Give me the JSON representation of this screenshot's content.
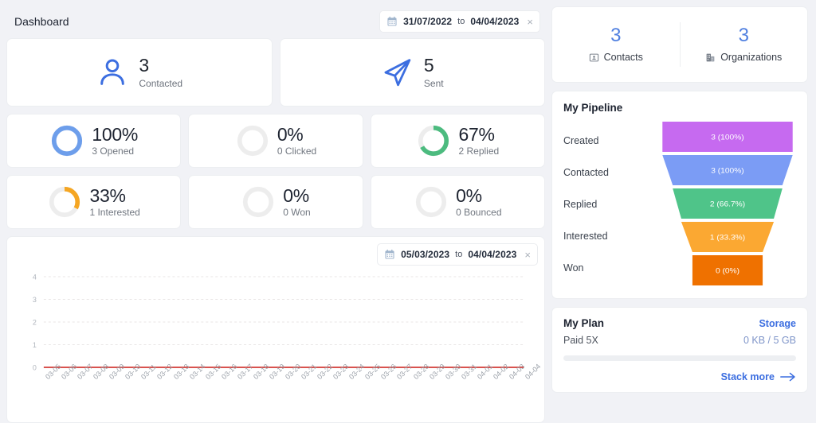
{
  "header": {
    "title": "Dashboard",
    "date_range": {
      "icon": "calendar-icon",
      "start": "31/07/2022",
      "sep": "to",
      "end": "04/04/2023",
      "clear": "×"
    }
  },
  "big_stats": [
    {
      "icon": "person-icon",
      "value": "3",
      "label": "Contacted"
    },
    {
      "icon": "paper-plane-icon",
      "value": "5",
      "label": "Sent"
    }
  ],
  "donut_stats": [
    {
      "percent": "100%",
      "label": "3 Opened",
      "value": 100,
      "color": "#6d9eeb"
    },
    {
      "percent": "0%",
      "label": "0 Clicked",
      "value": 0,
      "color": "#ededed"
    },
    {
      "percent": "67%",
      "label": "2 Replied",
      "value": 67,
      "color": "#4cbb7f"
    },
    {
      "percent": "33%",
      "label": "1 Interested",
      "value": 33,
      "color": "#f5a623"
    },
    {
      "percent": "0%",
      "label": "0 Won",
      "value": 0,
      "color": "#ededed"
    },
    {
      "percent": "0%",
      "label": "0 Bounced",
      "value": 0,
      "color": "#ededed"
    }
  ],
  "chart_card": {
    "date_range": {
      "icon": "calendar-icon",
      "start": "05/03/2023",
      "sep": "to",
      "end": "04/04/2023",
      "clear": "×"
    }
  },
  "chart_data": {
    "type": "line",
    "title": "",
    "xlabel": "",
    "ylabel": "",
    "categories": [
      "03-05",
      "03-06",
      "03-07",
      "03-08",
      "03-09",
      "03-10",
      "03-11",
      "03-12",
      "03-13",
      "03-14",
      "03-15",
      "03-16",
      "03-17",
      "03-18",
      "03-19",
      "03-20",
      "03-21",
      "03-22",
      "03-23",
      "03-24",
      "03-25",
      "03-26",
      "03-27",
      "03-28",
      "03-29",
      "03-30",
      "03-31",
      "04-01",
      "04-02",
      "04-03",
      "04-04"
    ],
    "series": [
      {
        "name": "",
        "color": "#d9534f",
        "values": [
          0,
          0,
          0,
          0,
          0,
          0,
          0,
          0,
          0,
          0,
          0,
          0,
          0,
          0,
          0,
          0,
          0,
          0,
          0,
          0,
          0,
          0,
          0,
          0,
          0,
          0,
          0,
          0,
          0,
          0,
          0
        ]
      }
    ],
    "yticks": [
      "4",
      "3",
      "2",
      "1",
      "0"
    ],
    "ylim": [
      0,
      4
    ],
    "grid": true,
    "legend": "none"
  },
  "kpis": [
    {
      "value": "3",
      "label": "Contacts",
      "icon": "contact-card-icon"
    },
    {
      "value": "3",
      "label": "Organizations",
      "icon": "building-icon"
    }
  ],
  "pipeline": {
    "title": "My Pipeline",
    "stages": [
      {
        "name": "Created",
        "label": "3 (100%)",
        "count": 3,
        "percent": 100,
        "color": "#c66af0"
      },
      {
        "name": "Contacted",
        "label": "3 (100%)",
        "count": 3,
        "percent": 100,
        "color": "#7b9cf5"
      },
      {
        "name": "Replied",
        "label": "2 (66.7%)",
        "count": 2,
        "percent": 66.7,
        "color": "#4fc489"
      },
      {
        "name": "Interested",
        "label": "1 (33.3%)",
        "count": 1,
        "percent": 33.3,
        "color": "#fba832"
      },
      {
        "name": "Won",
        "label": "0 (0%)",
        "count": 0,
        "percent": 0,
        "color": "#ef7100"
      }
    ]
  },
  "plan": {
    "title": "My Plan",
    "storage_label": "Storage",
    "name": "Paid 5X",
    "usage": "0 KB / 5 GB",
    "usage_percent": 0,
    "stack_more": "Stack more"
  }
}
